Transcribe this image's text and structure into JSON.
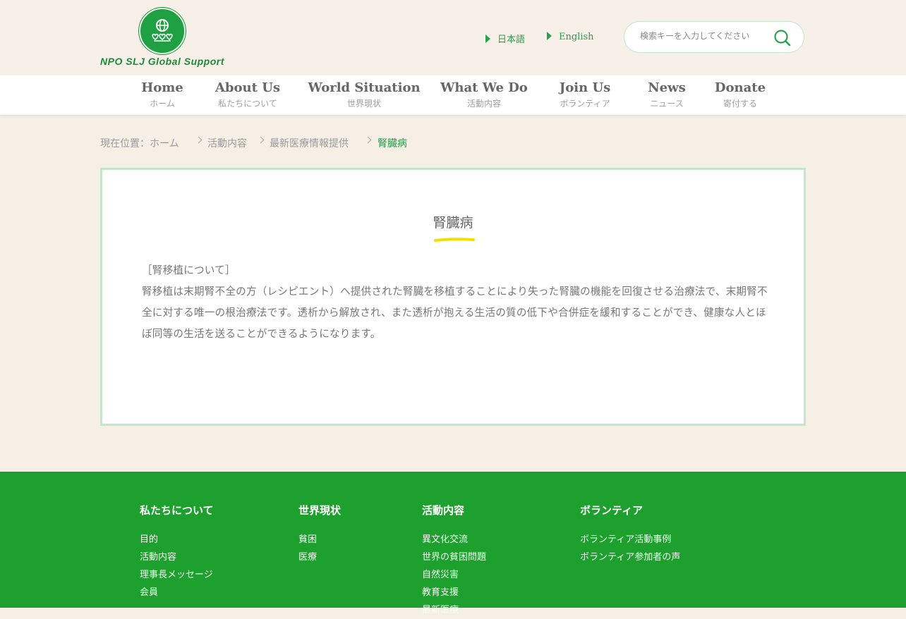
{
  "header": {
    "logo_text": "NPO SLJ Global Support",
    "lang_ja": "日本語",
    "lang_en": "English",
    "search_placeholder": "検索キーを入力してください"
  },
  "nav": [
    {
      "en": "Home",
      "jp": "ホーム"
    },
    {
      "en": "About Us",
      "jp": "私たちについて"
    },
    {
      "en": "World Situation",
      "jp": "世界現状"
    },
    {
      "en": "What We Do",
      "jp": "活動内容"
    },
    {
      "en": "Join Us",
      "jp": "ボランティア"
    },
    {
      "en": "News",
      "jp": "ニュース"
    },
    {
      "en": "Donate",
      "jp": "寄付する"
    }
  ],
  "breadcrumb": {
    "prefix": "現在位置：ホーム",
    "level1": "活動内容",
    "level2": "最新医療情報提供",
    "current": "腎臓病"
  },
  "article": {
    "title": "腎臓病",
    "heading": "［腎移植について］",
    "body": "腎移植は末期腎不全の方（レシピエント）へ提供された腎臓を移植することにより失った腎臓の機能を回復させる治療法で、末期腎不全に対する唯一の根治療法です。透析から解放され、また透析が抱える生活の質の低下や合併症を緩和することができ、健康な人とほぼ同等の生活を送ることができるようになります。"
  },
  "footer": {
    "col1": {
      "head": "私たちについて",
      "links": [
        "目的",
        "活動内容",
        "理事長メッセージ",
        "会員"
      ]
    },
    "col2": {
      "head": "世界現状",
      "links": [
        "貧困",
        "医療"
      ]
    },
    "col3": {
      "head": "活動内容",
      "links": [
        "異文化交流",
        "世界の貧困問題",
        "自然災害",
        "教育支援",
        "最新医療"
      ]
    },
    "col4": {
      "head": "ボランティア",
      "links": [
        "ボランティア活動事例",
        "ボランティア参加者の声"
      ]
    }
  },
  "colors": {
    "brand_green": "#1ea02f",
    "accent_yellow": "#f2e000",
    "panel_border": "#c3e7cb"
  }
}
